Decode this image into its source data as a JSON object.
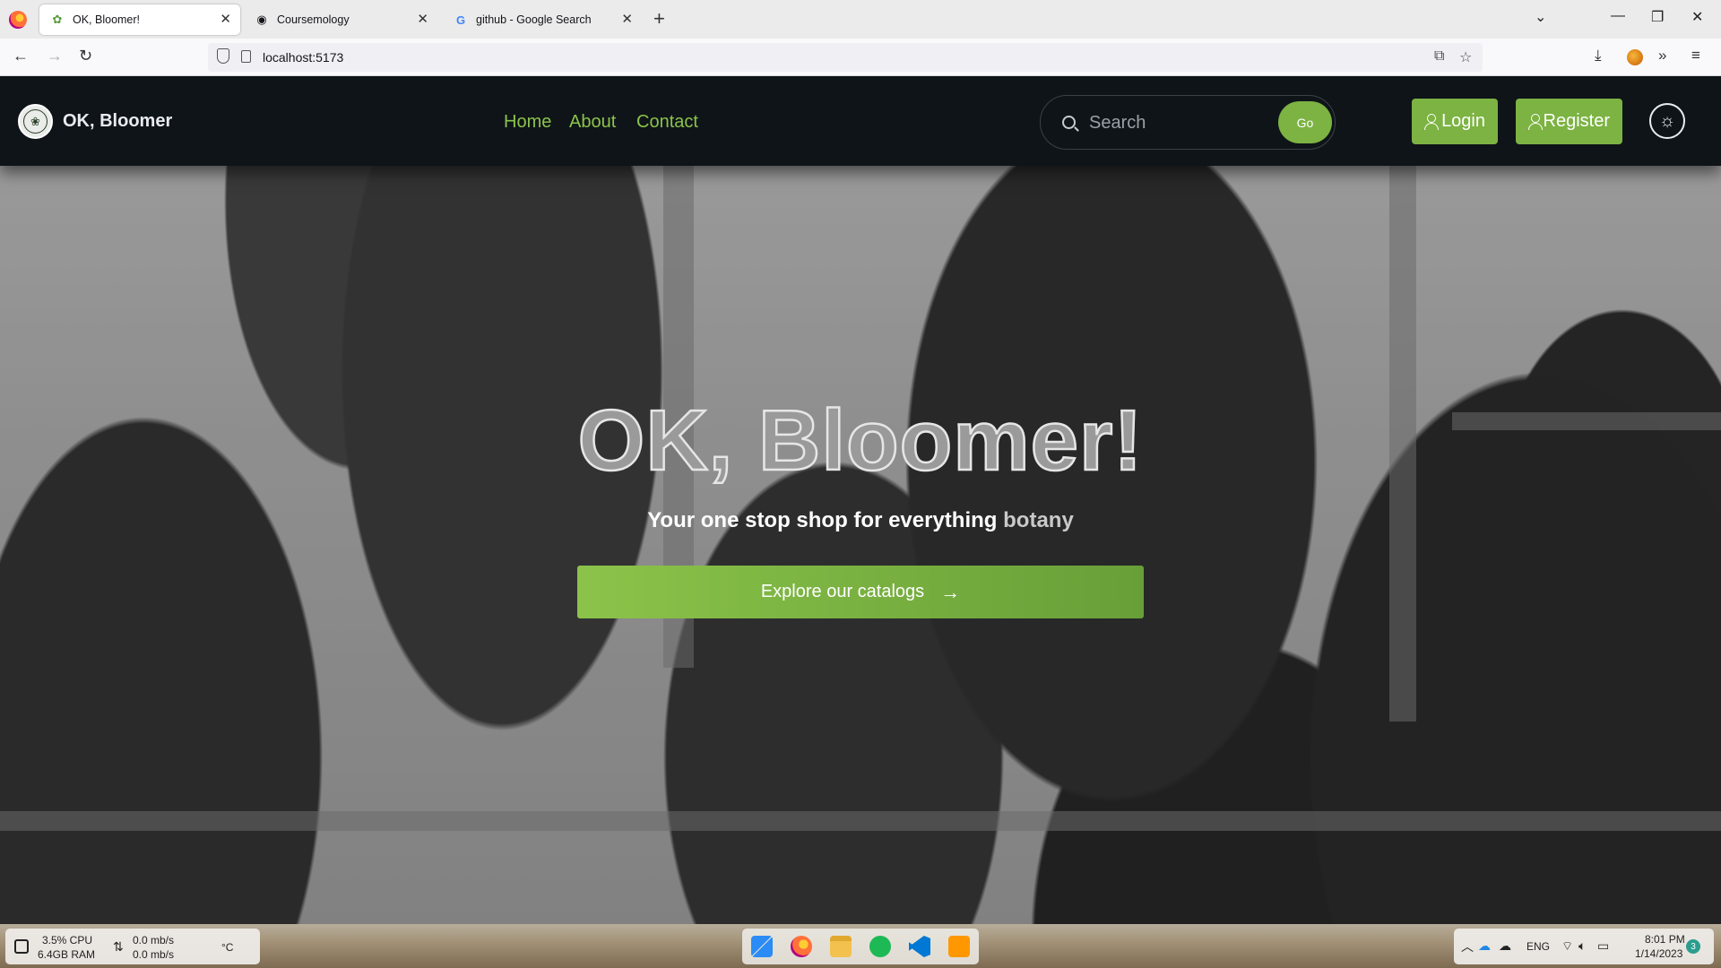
{
  "browser": {
    "tabs": [
      {
        "title": "OK, Bloomer!",
        "icon": "plant-favicon",
        "active": true
      },
      {
        "title": "Coursemology",
        "icon": "coursemology-favicon",
        "active": false
      },
      {
        "title": "github - Google Search",
        "icon": "google-favicon",
        "active": false
      }
    ],
    "url": "localhost:5173"
  },
  "header": {
    "brand": "OK, Bloomer",
    "nav": [
      "Home",
      "About",
      "Contact"
    ],
    "search_placeholder": "Search",
    "search_button": "Go",
    "login": "Login",
    "register": "Register",
    "accent_color": "#8bc34a",
    "bg_color": "#0f1419"
  },
  "hero": {
    "title": "OK, Bloomer!",
    "subtitle_main": "Your one stop shop for everything",
    "subtitle_accent": "botany",
    "cta": "Explore our catalogs"
  },
  "taskbar": {
    "cpu": "3.5% CPU",
    "ram": "6.4GB RAM",
    "net_up": "0.0 mb/s",
    "net_down": "0.0 mb/s",
    "temp": "°C",
    "lang": "ENG",
    "time": "8:01 PM",
    "date": "1/14/2023",
    "notifications": "3"
  }
}
